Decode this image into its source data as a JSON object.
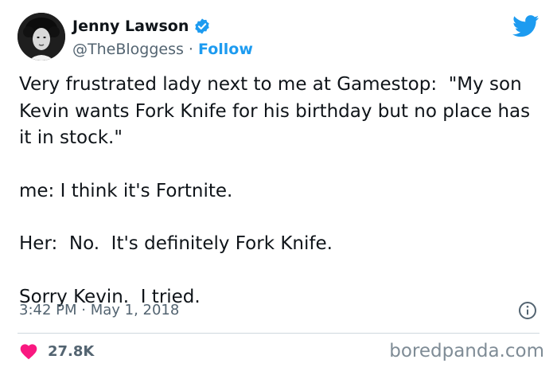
{
  "author": {
    "name": "Jenny Lawson",
    "handle": "@TheBloggess",
    "separator": " · ",
    "follow_label": "Follow",
    "avatar_icon": "profile-photo",
    "verified_icon": "verified-badge-icon"
  },
  "tweet": {
    "paragraphs": [
      "Very frustrated lady next to me at Gamestop:  \"My son Kevin wants Fork Knife for his birthday but no place has it in stock.\"",
      "me: I think it's Fortnite.",
      "Her:  No.  It's definitely Fork Knife.",
      "Sorry Kevin.  I tried."
    ],
    "timestamp": "3:42 PM · May 1, 2018"
  },
  "engagement": {
    "like_count": "27.8K",
    "like_icon": "heart-icon",
    "info_icon": "info-icon"
  },
  "platform_icon": "twitter-bird-icon",
  "watermark": "boredpanda.com",
  "colors": {
    "accent": "#1d9bf0",
    "like_red": "#f91880",
    "text": "#0f1419",
    "muted": "#536471"
  }
}
